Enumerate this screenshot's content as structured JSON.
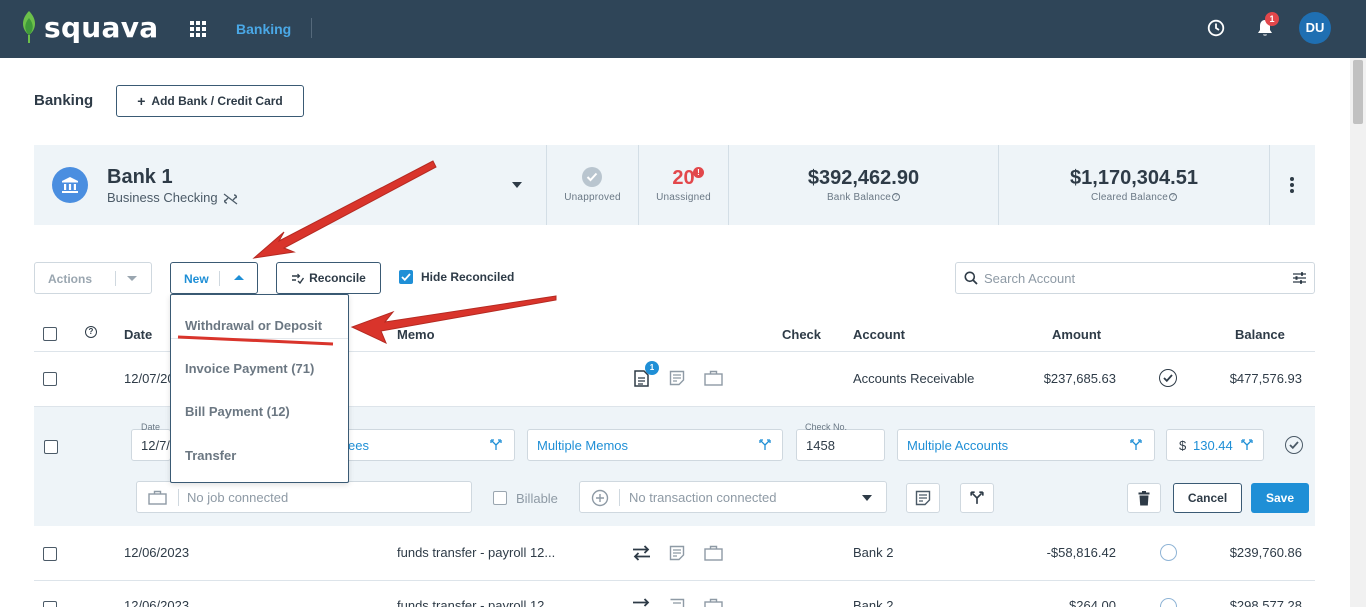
{
  "app": {
    "brand": "squava",
    "nav_active": "Banking",
    "notification_count": "1",
    "user_initials": "DU"
  },
  "page": {
    "title": "Banking",
    "add_button": "Add Bank / Credit Card"
  },
  "bank_card": {
    "name": "Bank 1",
    "type": "Business Checking",
    "unapproved_label": "Unapproved",
    "unassigned_count": "20",
    "unassigned_badge": "!",
    "unassigned_label": "Unassigned",
    "bank_balance": "$392,462.90",
    "bank_balance_label": "Bank Balance",
    "cleared_balance": "$1,170,304.51",
    "cleared_balance_label": "Cleared Balance"
  },
  "toolbar": {
    "actions_label": "Actions",
    "new_label": "New",
    "reconcile_label": "Reconcile",
    "hide_reconciled_label": "Hide Reconciled",
    "hide_reconciled_checked": true,
    "search_placeholder": "Search Account"
  },
  "new_menu": {
    "items": [
      "Withdrawal or Deposit",
      "Invoice Payment (71)",
      "Bill Payment (12)",
      "Transfer"
    ]
  },
  "table": {
    "headers": {
      "date": "Date",
      "memo": "Memo",
      "check": "Check",
      "account": "Account",
      "amount": "Amount",
      "balance": "Balance"
    },
    "rows": [
      {
        "date": "12/07/20",
        "memo": "",
        "doc_badge": "1",
        "account": "Accounts Receivable",
        "amount": "$237,685.63",
        "balance": "$477,576.93",
        "status": "approved"
      },
      {
        "date": "12/06/2023",
        "memo": "funds transfer - payroll 12...",
        "account": "Bank 2",
        "amount": "-$58,816.42",
        "balance": "$239,760.86",
        "status": "unapproved"
      },
      {
        "date": "12/06/2023",
        "memo": "funds transfer - payroll 12...",
        "account": "Bank 2",
        "amount": "$264.00",
        "balance": "$298,577.28",
        "status": "unapproved"
      }
    ]
  },
  "edit_row": {
    "date_label": "Date",
    "date_value": "12/7/",
    "payee_value": "ees",
    "memo_value": "Multiple Memos",
    "check_label": "Check No.",
    "check_value": "1458",
    "account_value": "Multiple Accounts",
    "amount_currency": "$",
    "amount_value": "130.44",
    "job_placeholder": "No job connected",
    "billable_label": "Billable",
    "transaction_placeholder": "No transaction connected",
    "cancel_label": "Cancel",
    "save_label": "Save"
  },
  "colors": {
    "topbar": "#2f4558",
    "accent": "#1f8fd6",
    "danger": "#e2474b",
    "annotation_arrow": "#d9342b"
  }
}
